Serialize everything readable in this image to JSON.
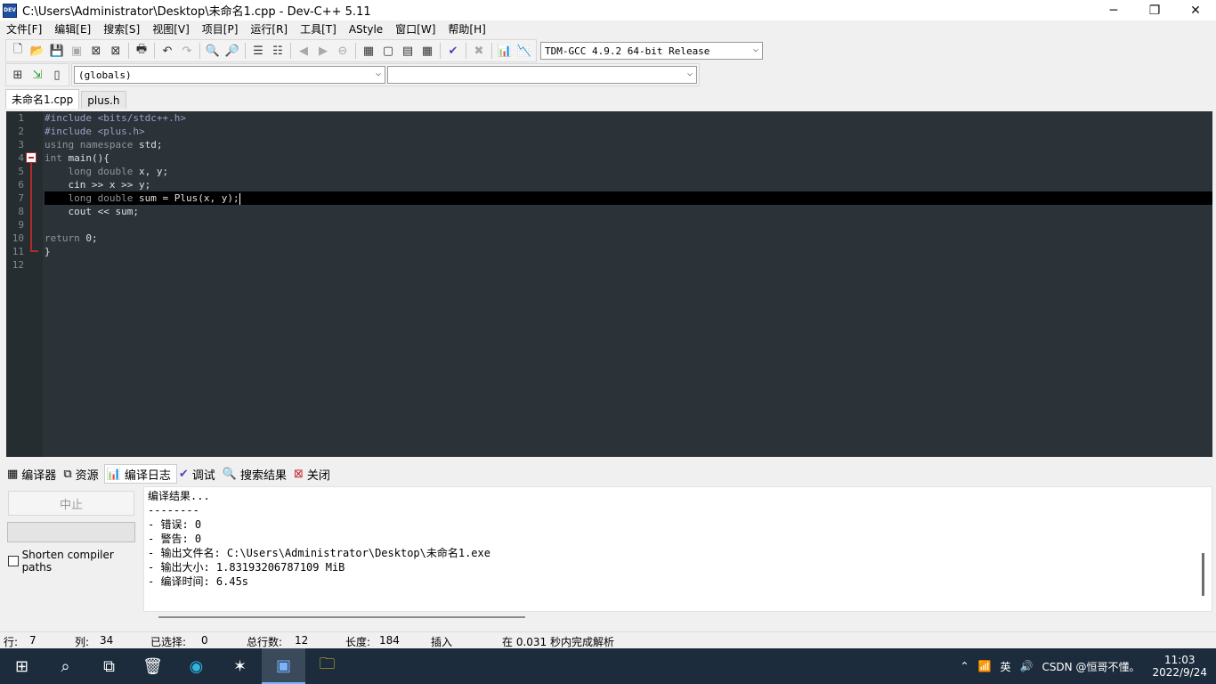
{
  "window": {
    "title": "C:\\Users\\Administrator\\Desktop\\未命名1.cpp - Dev-C++ 5.11",
    "icon_text": "DEV",
    "controls": [
      "─",
      "❐",
      "✕"
    ]
  },
  "menu": [
    "文件[F]",
    "编辑[E]",
    "搜索[S]",
    "视图[V]",
    "项目[P]",
    "运行[R]",
    "工具[T]",
    "AStyle",
    "窗口[W]",
    "帮助[H]"
  ],
  "toolbar": {
    "compiler_select": "TDM-GCC 4.9.2 64-bit Release",
    "scope_select": "(globals)",
    "function_select": ""
  },
  "tabs": [
    {
      "label": "未命名1.cpp",
      "active": true
    },
    {
      "label": "plus.h",
      "active": false
    }
  ],
  "editor": {
    "line_numbers": [
      "1",
      "2",
      "3",
      "4",
      "5",
      "6",
      "7",
      "8",
      "9",
      "10",
      "11",
      "12"
    ],
    "lines": [
      {
        "pp": "#include <bits/stdc++.h>"
      },
      {
        "pp": "#include <plus.h>"
      },
      {
        "kw": "using namespace",
        "rest": " std;"
      },
      {
        "kw": "int",
        "rest": " main(){"
      },
      {
        "indent": "    ",
        "kw": "long double",
        "rest": " x, y;"
      },
      {
        "indent": "    ",
        "rest": "cin >> x >> y;"
      },
      {
        "indent": "    ",
        "kw": "long double",
        "rest": " sum = Plus(x, y);"
      },
      {
        "indent": "    ",
        "rest": "cout << sum;"
      },
      {
        "rest": ""
      },
      {
        "kw": "return",
        "rest": " 0;"
      },
      {
        "rest": "}"
      },
      {
        "rest": ""
      }
    ],
    "current_line": 7
  },
  "bottom_tabs": [
    {
      "label": "编译器",
      "icon": "grid-icon"
    },
    {
      "label": "资源",
      "icon": "resources-icon"
    },
    {
      "label": "编译日志",
      "icon": "bar-chart-icon",
      "active": true
    },
    {
      "label": "调试",
      "icon": "check-icon"
    },
    {
      "label": "搜索结果",
      "icon": "search-icon"
    },
    {
      "label": "关闭",
      "icon": "close-icon"
    }
  ],
  "compile_panel": {
    "abort_label": "中止",
    "shorten_paths_label": "Shorten compiler paths",
    "log": [
      "编译结果...",
      "--------",
      "- 错误: 0",
      "- 警告: 0",
      "- 输出文件名: C:\\Users\\Administrator\\Desktop\\未命名1.exe",
      "- 输出大小: 1.83193206787109 MiB",
      "- 编译时间: 6.45s"
    ]
  },
  "status": {
    "row_label": "行:",
    "row": "7",
    "col_label": "列:",
    "col": "34",
    "sel_label": "已选择:",
    "sel": "0",
    "total_label": "总行数:",
    "total": "12",
    "len_label": "长度:",
    "len": "184",
    "mode": "插入",
    "parse": "在 0.031 秒内完成解析"
  },
  "taskbar": {
    "time": "11:03",
    "date": "2022/9/24",
    "tray_text": "CSDN @恒哥不懂。",
    "ime": "英"
  }
}
